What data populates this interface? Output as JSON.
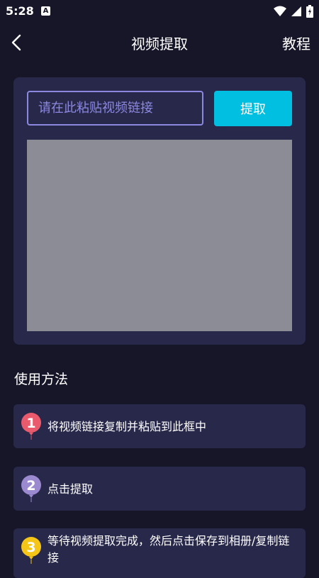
{
  "status_bar": {
    "time": "5:28",
    "notification_icon": "A"
  },
  "header": {
    "title": "视频提取",
    "tutorial_label": "教程"
  },
  "extract": {
    "placeholder": "请在此粘贴视频链接",
    "value": "",
    "button_label": "提取"
  },
  "usage": {
    "title": "使用方法",
    "steps": [
      {
        "number": "1",
        "text": "将视频链接复制并粘贴到此框中",
        "color": "#e85a6c"
      },
      {
        "number": "2",
        "text": "点击提取",
        "color": "#9b8ad0"
      },
      {
        "number": "3",
        "text": "等待视频提取完成，然后点击保存到相册/复制链接",
        "color": "#f5c518"
      }
    ]
  },
  "colors": {
    "background": "#171629",
    "card": "#28284b",
    "accent": "#00bfe0",
    "input_border": "#8c88e0",
    "preview": "#8b8c96"
  }
}
